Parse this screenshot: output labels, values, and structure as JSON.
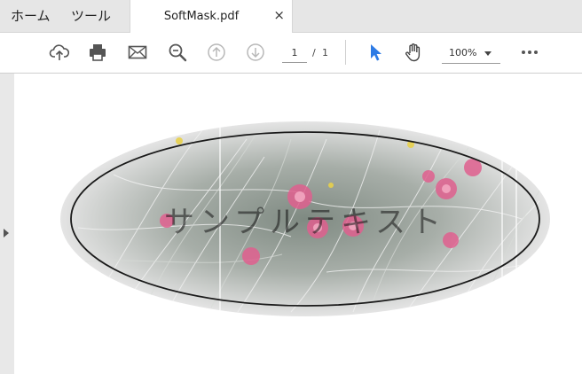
{
  "menubar": {
    "home_label": "ホーム",
    "tools_label": "ツール"
  },
  "tab": {
    "title": "SoftMask.pdf",
    "close_glyph": "×"
  },
  "toolbar": {
    "icons": [
      "upload-icon",
      "print-icon",
      "mail-icon",
      "zoom-out-icon",
      "prev-page-icon",
      "next-page-icon",
      "select-tool-icon",
      "hand-tool-icon",
      "more-icon"
    ],
    "current_page": "1",
    "page_separator": "/",
    "total_pages": "1",
    "zoom": "100%",
    "accent_color": "#2d7be5"
  },
  "document": {
    "caption": "サンプルテキスト"
  }
}
